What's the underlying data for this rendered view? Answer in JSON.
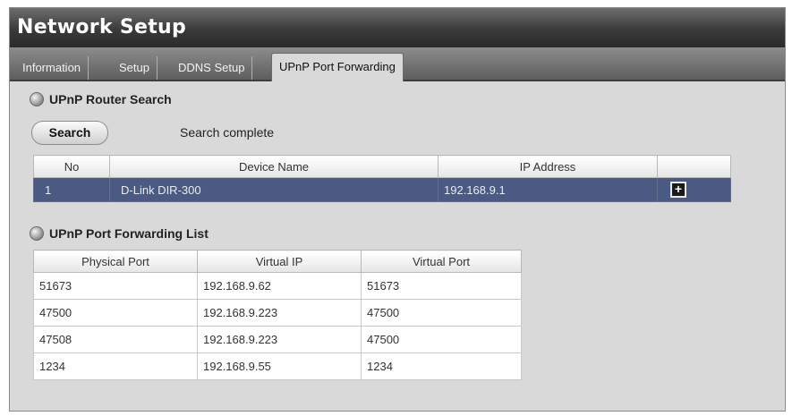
{
  "window": {
    "title": "Network Setup"
  },
  "tabs": [
    {
      "label": "Information"
    },
    {
      "label": "Setup"
    },
    {
      "label": "DDNS Setup"
    },
    {
      "label": "UPnP Port Forwarding",
      "active": true
    }
  ],
  "router_search": {
    "title": "UPnP Router Search",
    "search_button": "Search",
    "status": "Search complete",
    "columns": [
      "No",
      "Device Name",
      "IP Address",
      ""
    ],
    "rows": [
      {
        "no": "1",
        "device": "D-Link DIR-300",
        "ip": "192.168.9.1",
        "selected": true
      }
    ]
  },
  "port_forwarding": {
    "title": "UPnP Port Forwarding List",
    "columns": [
      "Physical Port",
      "Virtual IP",
      "Virtual Port"
    ],
    "rows": [
      {
        "physical_port": "51673",
        "virtual_ip": "192.168.9.62",
        "virtual_port": "51673"
      },
      {
        "physical_port": "47500",
        "virtual_ip": "192.168.9.223",
        "virtual_port": "47500"
      },
      {
        "physical_port": "47508",
        "virtual_ip": "192.168.9.223",
        "virtual_port": "47500"
      },
      {
        "physical_port": "1234",
        "virtual_ip": "192.168.9.55",
        "virtual_port": "1234"
      }
    ]
  },
  "icons": {
    "section": "globe-icon",
    "row_action": "plus-icon"
  },
  "colors": {
    "selected_row": "#4a5a82",
    "titlebar": "#3a3a3a"
  }
}
